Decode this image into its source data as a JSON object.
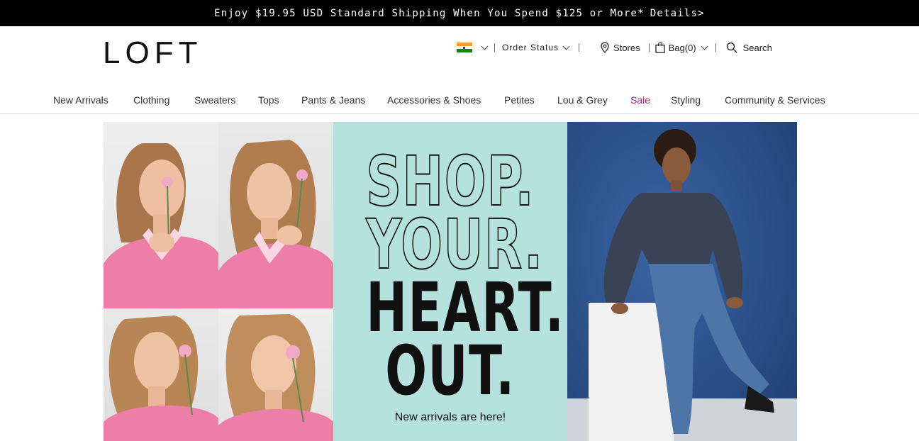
{
  "promo": {
    "text": "Enjoy $19.95 USD Standard Shipping When You Spend $125 or More*",
    "link": "Details>"
  },
  "header": {
    "logo": "LOFT",
    "order_status": "Order Status",
    "stores": "Stores",
    "bag": "Bag(0)",
    "search": "Search",
    "flag_colors": [
      "#ff9933",
      "#ffffff",
      "#138808"
    ]
  },
  "nav": {
    "items": [
      "New Arrivals",
      "Clothing",
      "Sweaters",
      "Tops",
      "Pants & Jeans",
      "Accessories & Shoes",
      "Petites",
      "Lou & Grey",
      "Sale",
      "Styling",
      "Community & Services"
    ],
    "sale_color": "#b0177f"
  },
  "hero": {
    "line1": "SHOP.",
    "line2": "YOUR.",
    "line3": "HEART.",
    "line4": "OUT.",
    "subtitle": "New arrivals are here!",
    "teal_color": "#b5e2dd",
    "denim_color": "#2a4f88"
  }
}
